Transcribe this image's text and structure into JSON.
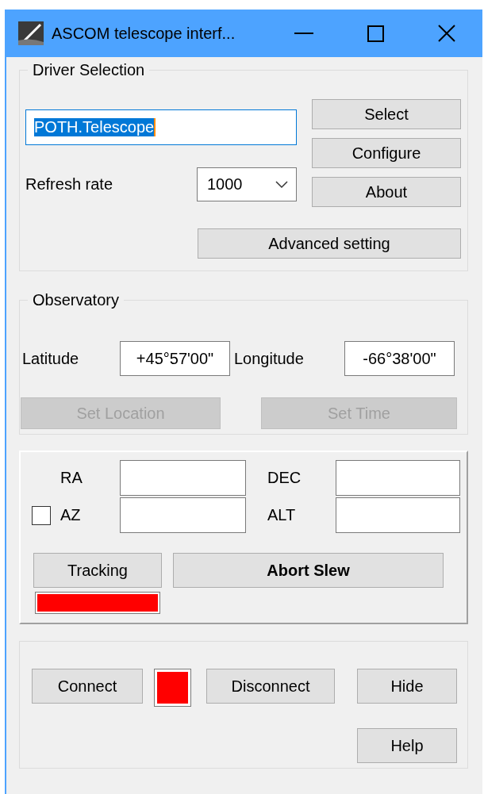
{
  "window": {
    "title": "ASCOM telescope interf..."
  },
  "driver_selection": {
    "title": "Driver Selection",
    "driver": {
      "value": "POTH.Telescope",
      "text_selected": true
    },
    "refresh_rate": {
      "label": "Refresh rate",
      "value": "1000"
    },
    "buttons": [
      {
        "label": "Select"
      },
      {
        "label": "Configure"
      },
      {
        "label": "About"
      }
    ],
    "advanced_button": {
      "label": "Advanced setting"
    }
  },
  "observatory": {
    "title": "Observatory",
    "latitude": {
      "label": "Latitude",
      "value": "+45°57'00\""
    },
    "longitude": {
      "label": "Longitude",
      "value": "-66°38'00\""
    },
    "buttons": [
      {
        "label": "Set Location",
        "disabled": true
      },
      {
        "label": "Set Time",
        "disabled": true
      }
    ]
  },
  "position": {
    "ra": {
      "label": "RA"
    },
    "dec": {
      "label": "DEC"
    },
    "az": {
      "label": "AZ",
      "checked": false
    },
    "alt": {
      "label": "ALT"
    },
    "tracking_button": {
      "label": "Tracking"
    },
    "tracking_indicator": {
      "color": "#ff0000"
    },
    "abort_button": {
      "label": "Abort Slew"
    }
  },
  "connection": {
    "connect_button": {
      "label": "Connect"
    },
    "status_indicator": {
      "color": "#ff0000"
    },
    "disconnect_button": {
      "label": "Disconnect"
    },
    "hide_button": {
      "label": "Hide"
    },
    "help_button": {
      "label": "Help"
    }
  }
}
